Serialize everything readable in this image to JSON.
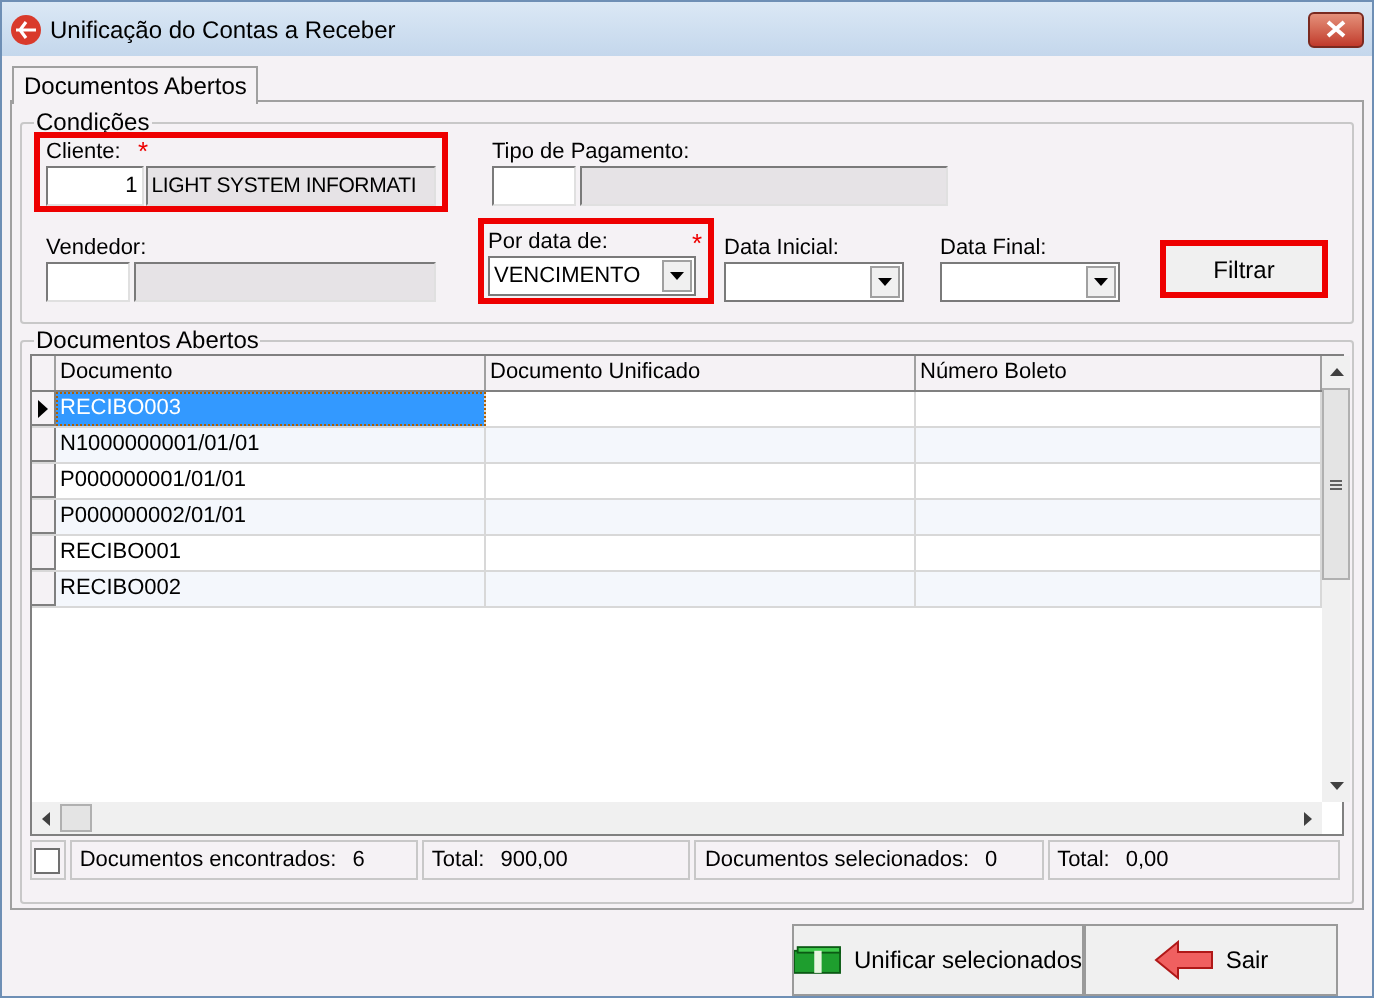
{
  "window": {
    "title": "Unificação do Contas a Receber"
  },
  "tabs": [
    {
      "label": "Documentos Abertos",
      "selected": true
    }
  ],
  "conditions": {
    "title": "Condições",
    "cliente": {
      "label": "Cliente:",
      "code": "1",
      "name": "LIGHT SYSTEM INFORMATI",
      "required_mark": "*",
      "highlighted": true
    },
    "tipo_pagamento": {
      "label": "Tipo de Pagamento:"
    },
    "vendedor": {
      "label": "Vendedor:"
    },
    "por_data": {
      "label": "Por data de:",
      "value": "VENCIMENTO",
      "required_mark": "*",
      "highlighted": true
    },
    "data_inicial": {
      "label": "Data Inicial:"
    },
    "data_final": {
      "label": "Data Final:"
    },
    "filter_button": {
      "label": "Filtrar",
      "highlighted": true
    }
  },
  "documents": {
    "title": "Documentos Abertos",
    "columns": [
      "Documento",
      "Documento Unificado",
      "Número Boleto"
    ],
    "rows": [
      {
        "cells": [
          "RECIBO003",
          "",
          ""
        ],
        "selected": true
      },
      {
        "cells": [
          "N1000000001/01/01",
          "",
          ""
        ],
        "selected": false
      },
      {
        "cells": [
          "P000000001/01/01",
          "",
          ""
        ],
        "selected": false
      },
      {
        "cells": [
          "P000000002/01/01",
          "",
          ""
        ],
        "selected": false
      },
      {
        "cells": [
          "RECIBO001",
          "",
          ""
        ],
        "selected": false
      },
      {
        "cells": [
          "RECIBO002",
          "",
          ""
        ],
        "selected": false
      }
    ],
    "status": {
      "checked": false,
      "segments": [
        {
          "label": "Documentos encontrados:",
          "value": "6"
        },
        {
          "label": "Total:",
          "value": "900,00"
        },
        {
          "label": "Documentos selecionados:",
          "value": "0"
        },
        {
          "label": "Total:",
          "value": "0,00"
        }
      ]
    }
  },
  "buttons": [
    {
      "label": "Unificar selecionados",
      "kind": "money"
    },
    {
      "label": "Sair",
      "kind": "exit"
    }
  ]
}
